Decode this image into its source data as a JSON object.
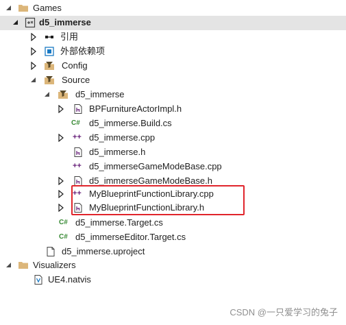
{
  "tree": {
    "games_folder": "Games",
    "project": "d5_immerse",
    "references": "引用",
    "external_deps": "外部依赖项",
    "config": "Config",
    "source": "Source",
    "source_folder": "d5_immerse",
    "files": [
      "BPFurnitureActorImpl.h",
      "d5_immerse.Build.cs",
      "d5_immerse.cpp",
      "d5_immerse.h",
      "d5_immerseGameModeBase.cpp",
      "d5_immerseGameModeBase.h",
      "MyBlueprintFunctionLibrary.cpp",
      "MyBlueprintFunctionLibrary.h"
    ],
    "target_cs": "d5_immerse.Target.cs",
    "editor_target_cs": "d5_immerseEditor.Target.cs",
    "uproject": "d5_immerse.uproject",
    "visualizers_folder": "Visualizers",
    "natvis": "UE4.natvis"
  },
  "watermark": "CSDN @一只爱学习的兔子",
  "icon_glyphs": {
    "csharp": "C#",
    "cpp": "++"
  },
  "colors": {
    "selection": "#e4e4e4",
    "highlight_border": "#e0242b",
    "folder": "#dcb67a",
    "cpp_icon": "#68217a",
    "csharp_icon": "#388a34"
  }
}
